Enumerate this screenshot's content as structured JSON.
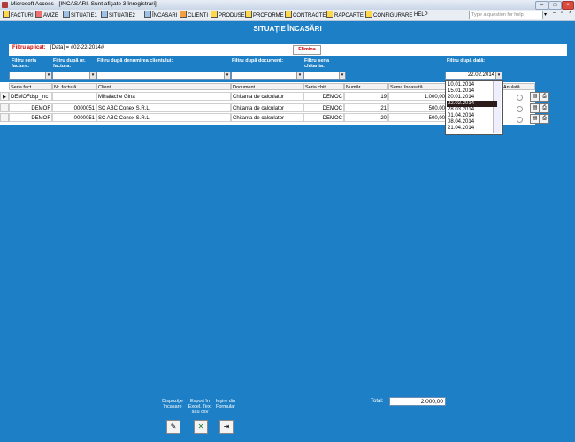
{
  "window": {
    "title": "Microsoft Access - [INCASARI. Sunt afişate 3 înregistrari]"
  },
  "menu": {
    "items": [
      "FACTURI",
      "AVIZE",
      "SITUATIE1",
      "SITUATIE2",
      "ÎNCASARI",
      "CLIENTI",
      "PRODUSE",
      "PROFORME",
      "CONTRACTE",
      "RAPOARTE",
      "CONFIGURARE",
      "HELP"
    ],
    "help_placeholder": "Type a question for help"
  },
  "form": {
    "title": "SITUAŢIE ÎNCASĂRI",
    "filter_label": "Filtru aplicat:",
    "filter_value": "[Data] = #02-22-2014#",
    "remove_button": "Elimina"
  },
  "filters": {
    "serie_factura": "Filtru seria factura:",
    "nr_factura": "Filtru după nr. factura:",
    "client": "Filtru după denumirea clientului:",
    "document": "Filtru după document:",
    "serie_chitanta": "Filtru seria chitanta:",
    "data": "Filtru după dată:",
    "data_value": "22.02.2014"
  },
  "table": {
    "columns": [
      "Seria fact.",
      "Nr. factură",
      "Client",
      "Document",
      "Seria chit.",
      "Număr",
      "Suma încasată",
      "Anulată"
    ],
    "rows": [
      {
        "serie": "DEMOFdsp_inc",
        "nr": "",
        "client": "Mihalache Gina",
        "document": "Chitanta de calculator",
        "serie_chit": "DEMOC",
        "numar": "19",
        "suma": "1.000,00"
      },
      {
        "serie": "DEMOF",
        "nr": "0000051",
        "client": "SC ABC Conex S.R.L.",
        "document": "Chitanta de calculator",
        "serie_chit": "DEMOC",
        "numar": "21",
        "suma": "500,00"
      },
      {
        "serie": "DEMOF",
        "nr": "0000051",
        "client": "SC ABC Conex S.R.L.",
        "document": "Chitanta de calculator",
        "serie_chit": "DEMOC",
        "numar": "20",
        "suma": "500,00"
      }
    ]
  },
  "date_list": [
    "10.01.2014",
    "15.01.2014",
    "20.01.2014",
    "22.02.2014",
    "28.03.2014",
    "01.04.2014",
    "08.04.2014",
    "21.04.2014"
  ],
  "date_selected_index": 3,
  "bottom": {
    "btn1": "Dispoziţie încasare",
    "btn2": "Export în Excel, Text sau csv",
    "btn3": "Ieşire din Formular",
    "total_label": "Total:",
    "total_value": "2.000,00"
  },
  "colors": {
    "background": "#1d7fc5",
    "accent_red": "#cc0000"
  }
}
